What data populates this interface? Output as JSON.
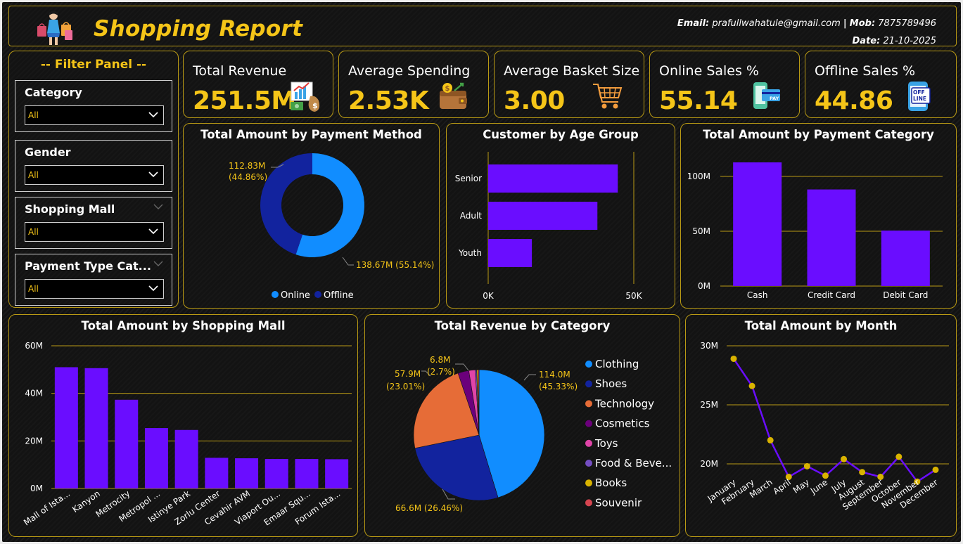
{
  "header": {
    "title": "Shopping Report",
    "email_label": "Email:",
    "email": "prafullwahatule@gmail.com",
    "separator": "|",
    "mob_label": "Mob:",
    "mob": "7875789496",
    "date_label": "Date:",
    "date": "21-10-2025"
  },
  "filter_panel": {
    "title": "-- Filter Panel --",
    "slicers": [
      {
        "label": "Category",
        "value": "All"
      },
      {
        "label": "Gender",
        "value": "All"
      },
      {
        "label": "Shopping Mall",
        "value": "All"
      },
      {
        "label": "Payment Type Cat...",
        "value": "All"
      }
    ]
  },
  "kpis": [
    {
      "label": "Total Revenue",
      "value": "251.5M",
      "icon": "revenue-chart-icon"
    },
    {
      "label": "Average Spending",
      "value": "2.53K",
      "icon": "wallet-icon"
    },
    {
      "label": "Average Basket Size",
      "value": "3.00",
      "icon": "shopping-cart-icon"
    },
    {
      "label": "Online Sales %",
      "value": "55.14",
      "icon": "online-payment-icon"
    },
    {
      "label": "Offline Sales %",
      "value": "44.86",
      "icon": "offline-icon"
    }
  ],
  "colors": {
    "accent": "#f5c518",
    "border": "#b99a14",
    "bar": "#6a0dff",
    "online": "#118dff",
    "offline": "#12239e"
  },
  "chart_data": [
    {
      "id": "payment-method",
      "type": "pie",
      "title": "Total Amount by Payment Method",
      "donut": true,
      "categories": [
        "Online",
        "Offline"
      ],
      "values": [
        138.67,
        112.83
      ],
      "data_labels": [
        "138.67M (55.14%)",
        "112.83M",
        "(44.86%)"
      ],
      "colors": [
        "#118dff",
        "#12239e"
      ],
      "legend": "bottom"
    },
    {
      "id": "age-group",
      "type": "bar",
      "orientation": "horizontal",
      "title": "Customer by Age Group",
      "categories": [
        "Senior",
        "Adult",
        "Youth"
      ],
      "values": [
        44.5,
        37.5,
        15
      ],
      "xlim": [
        0,
        50
      ],
      "tick_labels": [
        "0K",
        "50K"
      ]
    },
    {
      "id": "payment-category",
      "type": "bar",
      "title": "Total Amount by Payment Category",
      "categories": [
        "Cash",
        "Credit Card",
        "Debit Card"
      ],
      "values": [
        112.8,
        88.1,
        50.6
      ],
      "ylim": [
        0,
        100
      ],
      "tick_labels": [
        "0M",
        "50M",
        "100M"
      ]
    },
    {
      "id": "shopping-mall",
      "type": "bar",
      "title": "Total Amount by Shopping Mall",
      "categories": [
        "Mall of Ista...",
        "Kanyon",
        "Metrocity",
        "Metropol ...",
        "Istinye Park",
        "Zorlu Center",
        "Cevahir AVM",
        "Viaport Ou...",
        "Emaar Squ...",
        "Forum Ista..."
      ],
      "values": [
        51.0,
        50.6,
        37.3,
        25.4,
        24.6,
        12.9,
        12.7,
        12.4,
        12.4,
        12.3
      ],
      "ylim": [
        0,
        60
      ],
      "tick_labels": [
        "0M",
        "20M",
        "40M",
        "60M"
      ]
    },
    {
      "id": "category-revenue",
      "type": "pie",
      "title": "Total Revenue by Category",
      "categories": [
        "Clothing",
        "Shoes",
        "Technology",
        "Cosmetics",
        "Toys",
        "Food & Beve...",
        "Books",
        "Souvenir"
      ],
      "values": [
        114.0,
        66.6,
        57.9,
        6.8,
        3.98,
        0.85,
        0.83,
        0.64
      ],
      "data_labels": [
        "114.0M",
        "(45.33%)",
        "66.6M (26.46%)",
        "57.9M",
        "(23.01%)",
        "6.8M",
        "(2.7%)"
      ],
      "colors": [
        "#118dff",
        "#12239e",
        "#e66c37",
        "#6b007b",
        "#e044a7",
        "#744ec2",
        "#d9b300",
        "#d64550"
      ],
      "legend": "right"
    },
    {
      "id": "month",
      "type": "line",
      "title": "Total Amount by Month",
      "categories": [
        "January",
        "February",
        "March",
        "April",
        "May",
        "June",
        "July",
        "August",
        "September",
        "October",
        "November",
        "December"
      ],
      "values": [
        28.9,
        26.6,
        22.0,
        18.9,
        19.8,
        19.0,
        20.4,
        19.3,
        18.9,
        20.6,
        18.5,
        19.5
      ],
      "ylim": [
        17.5,
        30
      ],
      "tick_labels": [
        "20M",
        "25M",
        "30M"
      ]
    }
  ]
}
